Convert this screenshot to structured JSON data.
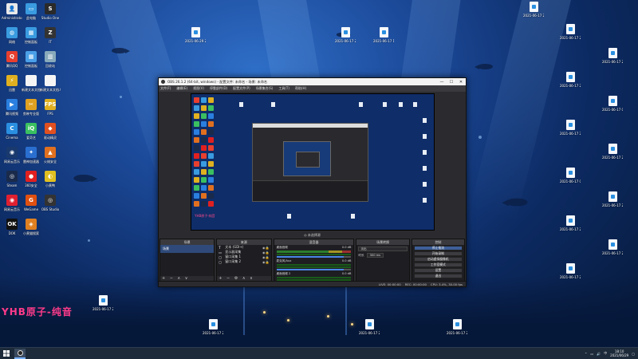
{
  "desktop": {
    "left_icons": [
      {
        "label": "Administrator",
        "color": "#e9e9e9",
        "glyph": "👤"
      },
      {
        "label": "此电脑",
        "color": "#3a9be0",
        "glyph": "▭"
      },
      {
        "label": "Studio One",
        "color": "#2a2a2a",
        "glyph": "S"
      },
      {
        "label": "网络",
        "color": "#3a9be0",
        "glyph": "◍"
      },
      {
        "label": "控制面板",
        "color": "#3a9be0",
        "glyph": "▦"
      },
      {
        "label": "IT",
        "color": "#333",
        "glyph": "Z"
      },
      {
        "label": "腾讯QQ",
        "color": "#e83f2f",
        "glyph": "Q"
      },
      {
        "label": "控制面板",
        "color": "#4aa0e8",
        "glyph": "▦"
      },
      {
        "label": "回收站",
        "color": "#8ab",
        "glyph": "▥"
      },
      {
        "label": "迅雷",
        "color": "#e0b020",
        "glyph": "⚡"
      },
      {
        "label": "新建文本文档",
        "color": "#f5f5f5",
        "glyph": ""
      },
      {
        "label": "新建文本文档.txt",
        "color": "#f5f5f5",
        "glyph": ""
      },
      {
        "label": "腾讯视频",
        "color": "#2a7fe0",
        "glyph": "▶"
      },
      {
        "label": "剪映专业版",
        "color": "#e0a020",
        "glyph": "✂"
      },
      {
        "label": "FPS",
        "color": "#e0b020",
        "glyph": "FPS"
      },
      {
        "label": "Cinema",
        "color": "#2a8fe0",
        "glyph": "C"
      },
      {
        "label": "爱奇艺",
        "color": "#3ac060",
        "glyph": "iQ"
      },
      {
        "label": "驱动精灵",
        "color": "#e05020",
        "glyph": "◆"
      },
      {
        "label": "网易云音乐",
        "color": "#1a3a6e",
        "glyph": "◉"
      },
      {
        "label": "雷神加速器",
        "color": "#2a6fd0",
        "glyph": "✦"
      },
      {
        "label": "火绒安全",
        "color": "#e07020",
        "glyph": "▲"
      },
      {
        "label": "Steam",
        "color": "#1a2a4a",
        "glyph": "◎"
      },
      {
        "label": "360安全",
        "color": "#e02020",
        "glyph": "●"
      },
      {
        "label": "小黄鸭",
        "color": "#e0c020",
        "glyph": "◐"
      },
      {
        "label": "网易云音乐",
        "color": "#e02030",
        "glyph": "◉"
      },
      {
        "label": "WeGame",
        "color": "#e05010",
        "glyph": "G"
      },
      {
        "label": "OBS Studio",
        "color": "#333",
        "glyph": "◎"
      },
      {
        "label": "DOK",
        "color": "#111",
        "glyph": "OK"
      },
      {
        "label": "小黄猫搜索",
        "color": "#e08020",
        "glyph": "◈"
      }
    ],
    "file_icons_top": [
      "2021-06-29 23-21-15",
      "2021-06-17 21-18-48",
      "2021-06-17 14-48-10",
      "2021-06-17 21-23-48"
    ],
    "file_icons_right": [
      "2021-06-17 21-20-07",
      "2021-06-17 21-23-48",
      "2021-06-17 22-09-22",
      "2021-06-17 06-28-03",
      "2021-06-17 21-30-39",
      "2021-06-17 21-40-02",
      "2021-06-17 06-28-04",
      "2021-06-17 21-29-56",
      "2021-06-17 21-40-08",
      "2021-06-17 21-40-14",
      "2021-06-17 21-29-58"
    ],
    "file_icons_mid": [
      "2021-06-17 21-01-53",
      "2021-06-17 21-40-06",
      "2021-06-17 21-10-13",
      "2021-06-17 21-40-08"
    ],
    "watermark": "YHB原子-纯音"
  },
  "obs": {
    "title": "OBS 26.1.2 (64-bit, windows) - 配置文件: 未命名 - 场景: 未命名",
    "menu": [
      "文件(F)",
      "编辑(E)",
      "视图(V)",
      "停靠部件(D)",
      "配置文件(P)",
      "场景集合(S)",
      "工具(T)",
      "帮助(H)"
    ],
    "status_top": "◎ 未选择源",
    "docks": {
      "scenes": {
        "header": "场景",
        "items": [
          "场景"
        ],
        "footer": "+ − ∧ ∨"
      },
      "sources": {
        "header": "来源",
        "items": [
          "文本 (GDI+)",
          "显示器采集",
          "窗口采集 1",
          "窗口采集 2"
        ],
        "footer": "+ − ⚙ ∧ ∨"
      },
      "mixer": {
        "header": "混音器",
        "channels": [
          {
            "name": "桌面音频",
            "db": "0.0 dB"
          },
          {
            "name": "麦克风/Aux",
            "db": "0.0 dB"
          },
          {
            "name": "桌面音频 2",
            "db": "0.0 dB"
          }
        ]
      },
      "transitions": {
        "header": "场景转换",
        "type": "淡出",
        "duration_label": "时长",
        "duration": "300 ms"
      },
      "controls": {
        "header": "控制",
        "buttons": [
          "停止推流",
          "开始录制",
          "启动虚拟摄像机",
          "工作室模式",
          "设置",
          "退出"
        ]
      }
    },
    "statusbar": {
      "live": "LIVE: 00:00:00",
      "rec": "REC: 00:00:00",
      "cpu": "CPU: 3.4%, 30.00 fps"
    }
  },
  "taskbar": {
    "start_icon": "windows-icon",
    "time": "18:10",
    "date": "2021/06/29",
    "lang": "中"
  },
  "colors": {
    "accent": "#3d5f99",
    "obs_bg": "#2b2b2f",
    "desktop_dark": "#061734"
  }
}
